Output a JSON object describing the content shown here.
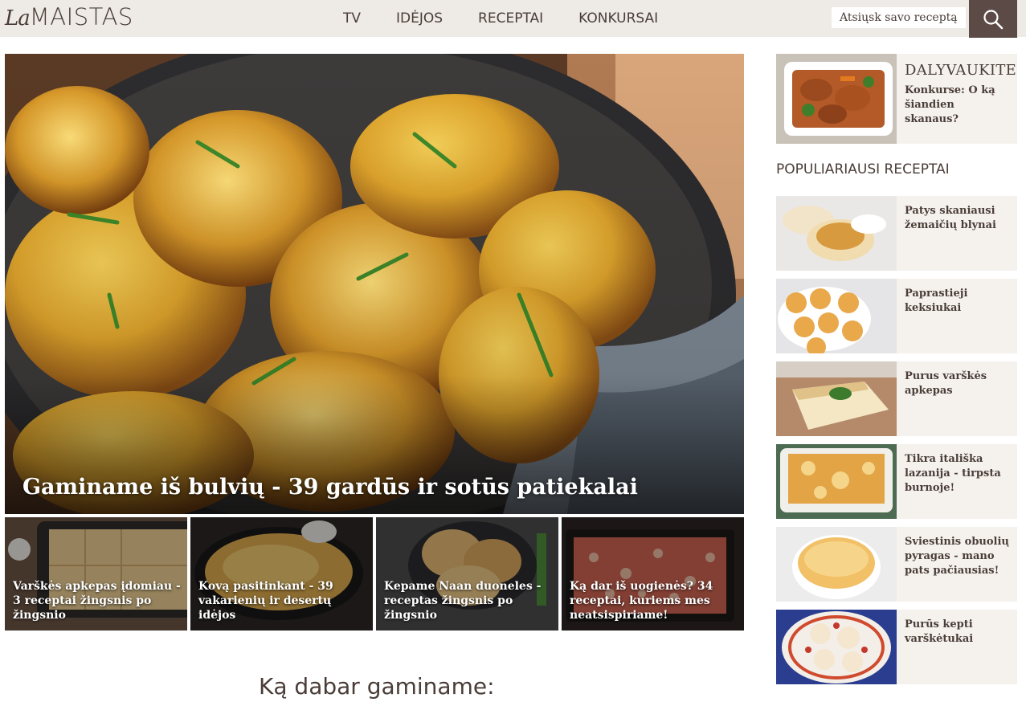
{
  "header": {
    "logo_la": "La",
    "logo_maistas": "MAISTAS",
    "nav": [
      "TV",
      "IDĖJOS",
      "RECEPTAI",
      "KONKURSAI"
    ],
    "submit_link": "Atsiųsk savo receptą",
    "search_icon": "search-icon"
  },
  "hero": {
    "title": "Gaminame iš bulvių - 39 gardūs ir sotūs patiekalai"
  },
  "cards": [
    {
      "label": "Varškės apkepas įdomiau - 3 receptai žingsnis po žingsnio"
    },
    {
      "label": "Kovą pasitinkant - 39 vakarienių ir desertų idėjos"
    },
    {
      "label": "Kepame Naan duoneles - receptas žingsnis po žingsnio"
    },
    {
      "label": "Ką dar iš uogienės? 34 receptai, kuriems mes neatsispiriame!"
    }
  ],
  "section": {
    "title": "Ką dabar gaminame:"
  },
  "sidebar": {
    "contest": {
      "title": "DALYVAUKITE",
      "subtitle": "Konkurse: O ką šiandien skanaus?"
    },
    "popular_heading": "POPULIARIAUSI RECEPTAI",
    "popular": [
      {
        "label": "Patys skaniausi žemaičių blynai"
      },
      {
        "label": "Paprastieji keksiukai"
      },
      {
        "label": "Purus varškės apkepas"
      },
      {
        "label": "Tikra itališka lazanija - tirpsta burnoje!"
      },
      {
        "label": "Sviestinis obuolių pyragas - mano pats pačiausias!"
      },
      {
        "label": "Purūs kepti varškėtukai"
      }
    ]
  },
  "colors": {
    "header_bg": "#eeeae6",
    "search_bg": "#5b4a46",
    "text": "#4a3d38",
    "card_bg": "#f5f2ee"
  }
}
